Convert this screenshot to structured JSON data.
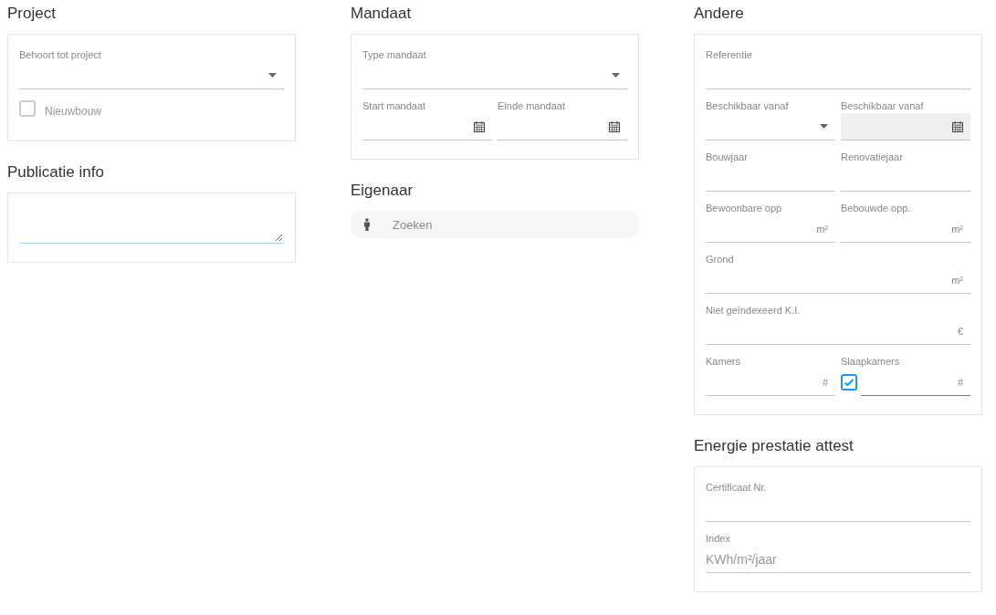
{
  "columns": [
    {
      "sections": [
        {
          "kind": "card",
          "title": "Project",
          "rows": [
            [
              {
                "kind": "select",
                "label": "Behoort tot project"
              }
            ],
            [
              {
                "kind": "checkbox",
                "label": "Nieuwbouw",
                "checked": false
              }
            ]
          ]
        },
        {
          "kind": "card",
          "title": "Publicatie info",
          "rows": [
            [
              {
                "kind": "textarea"
              }
            ]
          ]
        }
      ]
    },
    {
      "sections": [
        {
          "kind": "card",
          "title": "Mandaat",
          "rows": [
            [
              {
                "kind": "select",
                "label": "Type mandaat"
              }
            ],
            [
              {
                "kind": "date",
                "label": "Start mandaat",
                "disabled": false
              },
              {
                "kind": "date",
                "label": "Einde mandaat",
                "disabled": false
              }
            ]
          ]
        },
        {
          "kind": "search",
          "title": "Eigenaar",
          "placeholder": "Zoeken"
        }
      ]
    },
    {
      "sections": [
        {
          "kind": "card",
          "title": "Andere",
          "rows": [
            [
              {
                "kind": "text",
                "label": "Referentie"
              }
            ],
            [
              {
                "kind": "select",
                "label": "Beschikbaar vanaf"
              },
              {
                "kind": "date",
                "label": "Beschikbaar vanaf",
                "disabled": true
              }
            ],
            [
              {
                "kind": "text",
                "label": "Bouwjaar"
              },
              {
                "kind": "text",
                "label": "Renovatiejaar"
              }
            ],
            [
              {
                "kind": "text",
                "label": "Bewoonbare opp",
                "suffix": "m²"
              },
              {
                "kind": "text",
                "label": "Bebouwde opp.",
                "suffix": "m²"
              }
            ],
            [
              {
                "kind": "text",
                "label": "Grond",
                "suffix": "m²"
              }
            ],
            [
              {
                "kind": "text",
                "label": "Niet geïndexeerd K.I.",
                "suffix": "€"
              }
            ],
            [
              {
                "kind": "text",
                "label": "Kamers",
                "suffix": "#"
              },
              {
                "kind": "text",
                "label": "Slaapkamers",
                "suffix": "#",
                "checked": true
              }
            ]
          ]
        },
        {
          "kind": "card",
          "title": "Energie prestatie attest",
          "rows": [
            [
              {
                "kind": "text",
                "label": "Certificaat Nr."
              }
            ],
            [
              {
                "kind": "text",
                "label": "Index",
                "placeholder": "KWh/m²/jaar"
              }
            ]
          ]
        }
      ]
    }
  ]
}
